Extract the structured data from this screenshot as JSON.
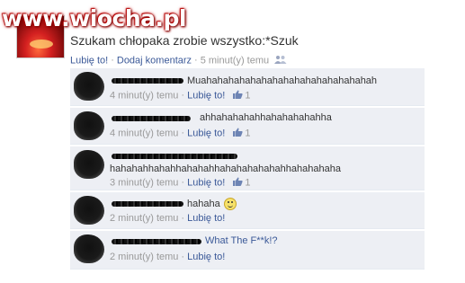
{
  "watermark": "www.wiocha.pl",
  "post": {
    "text": "Szukam chłopaka zrobie wszystko:*Szuk",
    "like_link": "Lubię to!",
    "comment_link": "Dodaj komentarz",
    "time": "5 minut(y) temu"
  },
  "comments": [
    {
      "text": "Muahahahahahahahahahahahahahahahah",
      "time": "4 minut(y) temu",
      "like": "Lubię to!",
      "likes": "1"
    },
    {
      "text": "ahhahahahahhahahahahahha",
      "time": "4 minut(y) temu",
      "like": "Lubię to!",
      "likes": "1"
    },
    {
      "text": "hahahahhahahhahahahhahahahahahahhahahahaha",
      "time": "3 minut(y) temu",
      "like": "Lubię to!",
      "likes": "1"
    },
    {
      "text": "hahaha",
      "time": "2 minut(y) temu",
      "like": "Lubię to!"
    },
    {
      "text": "What The F**k!?",
      "time": "2 minut(y) temu",
      "like": "Lubię to!"
    }
  ],
  "icons": {
    "people": "people-icon",
    "thumb": "thumbs-up-icon",
    "smiley": "smiley-icon"
  }
}
